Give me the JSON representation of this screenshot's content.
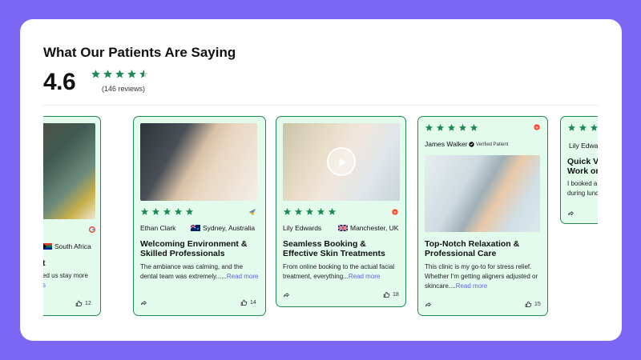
{
  "header": {
    "title": "What Our Patients Are Saying",
    "rating": "4.6",
    "reviews": "(146 reviews)"
  },
  "colors": {
    "accent": "#7c67f5",
    "star": "#1f8a54",
    "card_bg": "#e3fbed",
    "link": "#5a63f0"
  },
  "cards": [
    {
      "location": "South Africa",
      "title_fragment": "t",
      "text_fragment": "ed us stay more",
      "read_more": "s",
      "likes": "12",
      "source": "google-icon"
    },
    {
      "name": "Ethan Clark",
      "location": "Sydney, Australia",
      "title": "Welcoming Environment & Skilled Professionals",
      "text": "The ambiance was calming, and the dental team was extremely......",
      "read_more": "Read more",
      "likes": "14",
      "source": "arrow-brand-icon"
    },
    {
      "name": "Lily Edwards",
      "location": "Manchester, UK",
      "title": "Seamless Booking & Effective Skin Treatments",
      "text": "From online booking to the actual facial treatment, everything...",
      "read_more": "Read more",
      "likes": "18",
      "source": "g2-icon"
    },
    {
      "name": "James Walker",
      "badge": "Verified Patient",
      "title": "Top-Notch Relaxation & Professional Care",
      "text": "This clinic is my go-to for stress relief. Whether I'm getting aligners adjusted or skincare....",
      "read_more": "Read more",
      "likes": "15",
      "source": "g2-icon"
    },
    {
      "name": "Lily Edwards",
      "title": "Quick Visits B Work or Scho",
      "text": "I booked a last-m during lunch hour",
      "source": "google-icon"
    }
  ]
}
